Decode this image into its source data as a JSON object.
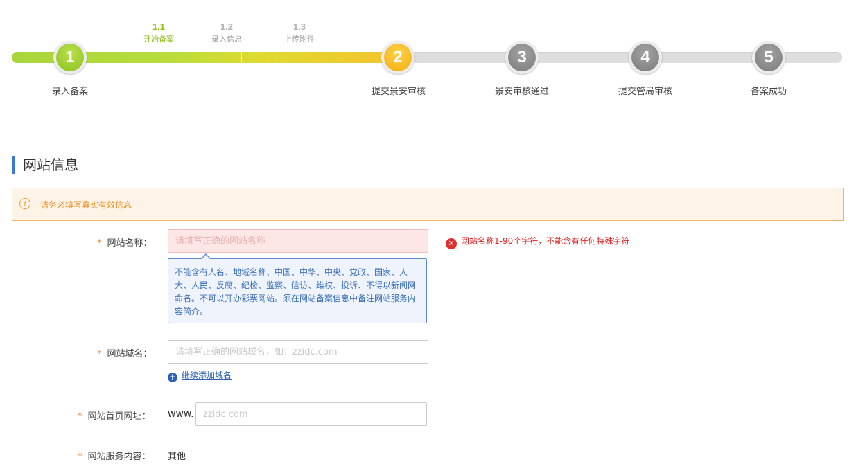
{
  "stepper": {
    "steps": [
      {
        "number": "1",
        "label": "录入备案",
        "state": "done"
      },
      {
        "number": "2",
        "label": "提交景安审核",
        "state": "current"
      },
      {
        "number": "3",
        "label": "景安审核通过",
        "state": "pending"
      },
      {
        "number": "4",
        "label": "提交管局审核",
        "state": "pending"
      },
      {
        "number": "5",
        "label": "备案成功",
        "state": "pending"
      }
    ],
    "substeps": [
      {
        "number": "1.1",
        "label": "开始备案",
        "active": true
      },
      {
        "number": "1.2",
        "label": "录入信息",
        "active": false
      },
      {
        "number": "1.3",
        "label": "上传附件",
        "active": false
      }
    ]
  },
  "section": {
    "title": "网站信息"
  },
  "notice": {
    "text": "请务必填写真实有效信息"
  },
  "form": {
    "required_mark": "*",
    "site_name": {
      "label": "网站名称：",
      "value": "",
      "placeholder": "请填写正确的网站名称",
      "error": "网站名称1-90个字符，不能含有任何特殊字符",
      "tip": "不能含有人名、地域名称、中国、中华、中央、党政、国家、人大、人民、反腐、纪检、监察、信访、维权、投诉、不得以新闻网命名。不可以开办彩票网站。须在网站备案信息中备注网站服务内容简介。"
    },
    "domain": {
      "label": "网站域名：",
      "value": "",
      "placeholder": "请填写正确的网站域名，如：zzidc.com",
      "add_link": "继续添加域名"
    },
    "homepage": {
      "label": "网站首页网址：",
      "prefix": "www.",
      "value": "",
      "placeholder": "zzidc.com"
    },
    "service_content": {
      "label": "网站服务内容：",
      "value": "其他"
    }
  },
  "colors": {
    "accent": "#3a78d8",
    "step_done": "#8cc21d",
    "step_current": "#f2ad0e",
    "step_pending": "#7c7c7c",
    "error": "#e02020",
    "notice": "#ee8a1a"
  },
  "icons": {
    "notice": "info-circle-icon",
    "error": "error-circle-icon",
    "add": "plus-circle-icon"
  }
}
